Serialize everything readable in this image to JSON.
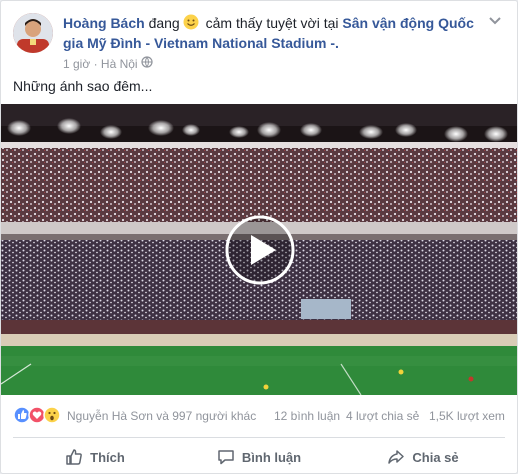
{
  "post": {
    "author": "Hoàng Bách",
    "feeling_prefix": "đang",
    "feeling_text": "cảm thấy tuyệt vời tại",
    "place": "Sân vận động Quốc gia Mỹ Đình - Vietnam National Stadium",
    "place_suffix": "-.",
    "time": "1 giờ",
    "separator": "·",
    "location": "Hà Nội",
    "text": "Những ánh sao đêm..."
  },
  "stats": {
    "reactors": "Nguyễn Hà Sơn và 997 người khác",
    "comments": "12 bình luận",
    "shares": "4 lượt chia sẻ",
    "views": "1,5K lượt xem",
    "reactions": [
      "like-icon",
      "love-icon",
      "wow-icon"
    ]
  },
  "actions": {
    "like": "Thích",
    "comment": "Bình luận",
    "share": "Chia sẻ"
  },
  "icons": [
    "smile-emoji-icon",
    "globe-icon",
    "chevron-down-icon",
    "play-icon"
  ],
  "colors": {
    "link": "#365899",
    "meta": "#90949c",
    "action": "#606770",
    "like_blue": "#5890ff",
    "love_red": "#f25268",
    "wow_yellow": "#fcd24a"
  }
}
